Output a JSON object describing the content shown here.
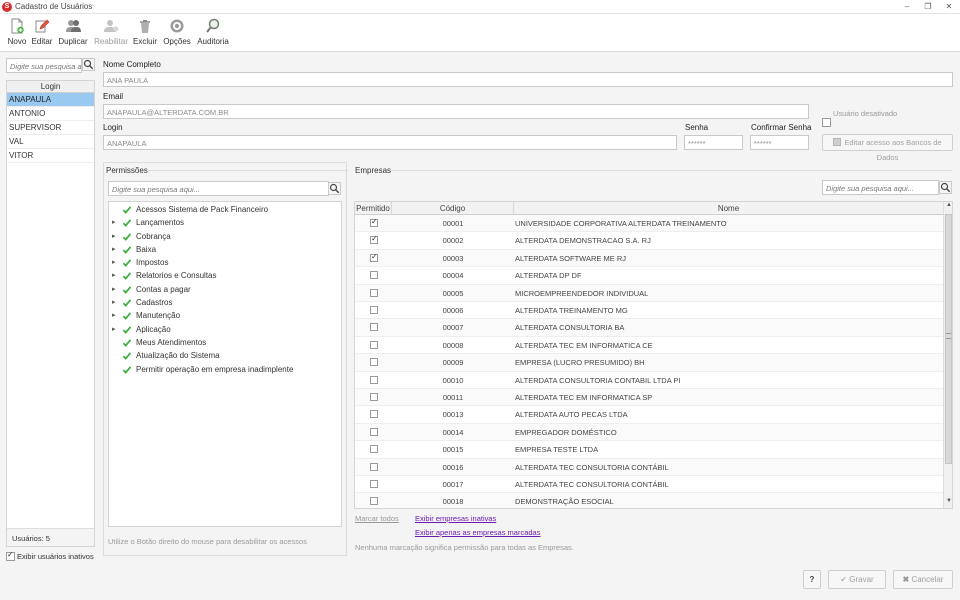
{
  "window": {
    "logo": "S",
    "title": "Cadastro de Usuários",
    "controls": {
      "minimize": "–",
      "restore": "❐",
      "close": "✕"
    }
  },
  "toolbar": {
    "novo": "Novo",
    "editar": "Editar",
    "duplicar": "Duplicar",
    "reabilitar": "Reabilitar",
    "excluir": "Excluir",
    "opcoes": "Opções",
    "auditoria": "Auditoria"
  },
  "users": {
    "search_placeholder": "Digite sua pesquisa aqui...",
    "column": "Login",
    "rows": [
      "ANAPAULA",
      "ANTONIO",
      "SUPERVISOR",
      "VAL",
      "VITOR"
    ],
    "count": "Usuários: 5",
    "show_inactive": "Exibir usuários inativos"
  },
  "form": {
    "nome_label": "Nome Completo",
    "nome_value": "ANA PAULA",
    "email_label": "Email",
    "email_value": "ANAPAULA@ALTERDATA.COM.BR",
    "login_label": "Login",
    "login_value": "ANAPAULA",
    "senha_label": "Senha",
    "senha_value": "******",
    "confirmar_label": "Confirmar Senha",
    "confirmar_value": "******",
    "desativado_label": "Usuário desativado",
    "editar_acesso": "Editar acesso aos Bancos de Dados"
  },
  "permissions": {
    "title": "Permissões",
    "search_placeholder": "Digite sua pesquisa aqui...",
    "items": [
      {
        "label": "Acessos Sistema de Pack Financeiro",
        "expandable": false
      },
      {
        "label": "Lançamentos",
        "expandable": true
      },
      {
        "label": "Cobrança",
        "expandable": true
      },
      {
        "label": "Baixa",
        "expandable": true
      },
      {
        "label": "Impostos",
        "expandable": true
      },
      {
        "label": "Relatorios e Consultas",
        "expandable": true
      },
      {
        "label": "Contas a pagar",
        "expandable": true
      },
      {
        "label": "Cadastros",
        "expandable": true
      },
      {
        "label": "Manutenção",
        "expandable": true
      },
      {
        "label": "Aplicação",
        "expandable": true
      },
      {
        "label": "Meus Atendimentos",
        "expandable": false
      },
      {
        "label": "Atualização do Sistema",
        "expandable": false
      },
      {
        "label": "Permitir operação em empresa inadimplente",
        "expandable": false
      }
    ],
    "hint": "Utilize o Botão direito do mouse para desabilitar os acessos"
  },
  "companies": {
    "title": "Empresas",
    "search_placeholder": "Digite sua pesquisa aqui...",
    "columns": {
      "permitido": "Permitido",
      "codigo": "Código",
      "nome": "Nome"
    },
    "rows": [
      {
        "checked": true,
        "code": "00001",
        "name": "UNIVERSIDADE CORPORATIVA ALTERDATA TREINAMENTO"
      },
      {
        "checked": true,
        "code": "00002",
        "name": "ALTERDATA DEMONSTRACAO S.A. RJ"
      },
      {
        "checked": true,
        "code": "00003",
        "name": "ALTERDATA SOFTWARE ME RJ"
      },
      {
        "checked": false,
        "code": "00004",
        "name": "ALTERDATA DP  DF"
      },
      {
        "checked": false,
        "code": "00005",
        "name": "MICROEMPREENDEDOR INDIVIDUAL"
      },
      {
        "checked": false,
        "code": "00006",
        "name": "ALTERDATA TREINAMENTO MG"
      },
      {
        "checked": false,
        "code": "00007",
        "name": "ALTERDATA CONSULTORIA BA"
      },
      {
        "checked": false,
        "code": "00008",
        "name": "ALTERDATA TEC EM INFORMATICA  CE"
      },
      {
        "checked": false,
        "code": "00009",
        "name": "EMPRESA (LUCRO PRESUMIDO) BH"
      },
      {
        "checked": false,
        "code": "00010",
        "name": "ALTERDATA CONSULTORIA CONTABIL LTDA  PI"
      },
      {
        "checked": false,
        "code": "00011",
        "name": "ALTERDATA TEC EM INFORMATICA SP"
      },
      {
        "checked": false,
        "code": "00013",
        "name": "ALTERDATA AUTO PECAS LTDA"
      },
      {
        "checked": false,
        "code": "00014",
        "name": "EMPREGADOR DOMÉSTICO"
      },
      {
        "checked": false,
        "code": "00015",
        "name": "EMPRESA TESTE LTDA"
      },
      {
        "checked": false,
        "code": "00016",
        "name": "ALTERDATA  TEC CONSULTORIA CONTÁBIL"
      },
      {
        "checked": false,
        "code": "00017",
        "name": "ALTERDATA  TEC CONSULTORIA CONTÁBIL"
      },
      {
        "checked": false,
        "code": "00018",
        "name": "DEMONSTRAÇÃO ESOCIAL"
      }
    ],
    "marcar_todos": "Marcar todos",
    "exibir_inativas": "Exibir empresas inativas",
    "exibir_marcadas": "Exibir apenas as empresas marcadas",
    "hint": "Nenhuma marcação significa permissão para todas as Empresas."
  },
  "footer": {
    "help": "?",
    "gravar": "Gravar",
    "cancelar": "Cancelar"
  },
  "colors": {
    "selection": "#99c9f0",
    "check_green": "#3fae3f",
    "link_purple": "#6a1bb0",
    "logo_red": "#d32f2f"
  }
}
